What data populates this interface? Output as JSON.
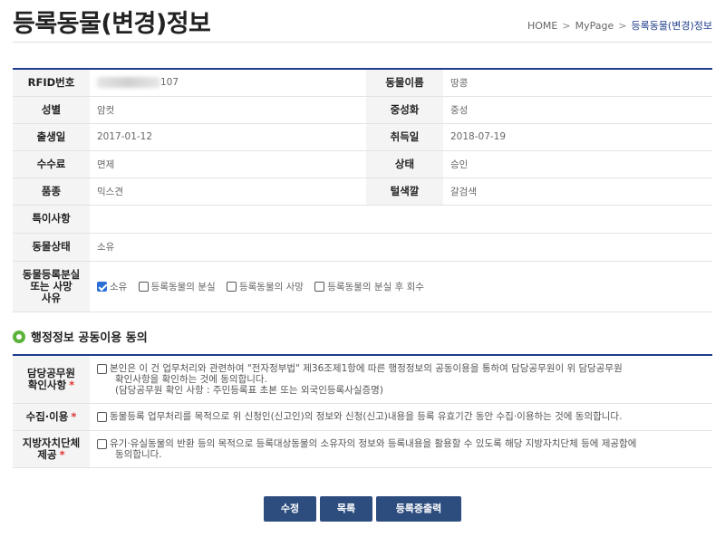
{
  "page": {
    "title": "등록동물(변경)정보"
  },
  "breadcrumb": {
    "home": "HOME",
    "separator": ">",
    "mypage": "MyPage",
    "current": "등록동물(변경)정보"
  },
  "info": {
    "rfid_label": "RFID번호",
    "rfid_suffix": "107",
    "animal_name_label": "동물이름",
    "animal_name": "땅콩",
    "sex_label": "성별",
    "sex": "암컷",
    "neuter_label": "중성화",
    "neuter": "중성",
    "birth_label": "출생일",
    "birth": "2017-01-12",
    "acquire_label": "취득일",
    "acquire": "2018-07-19",
    "fee_label": "수수료",
    "fee": "면제",
    "status_label": "상태",
    "status": "승인",
    "breed_label": "품종",
    "breed": "믹스견",
    "color_label": "털색깔",
    "color": "갈검색",
    "special_label": "특이사항",
    "special": "",
    "animal_state_label": "동물상태",
    "animal_state": "소유",
    "loss_reason_label_l1": "동물등록분실",
    "loss_reason_label_l2": "또는 사망",
    "loss_reason_label_l3": "사유",
    "loss_reason_options": [
      {
        "label": "소유",
        "checked": true
      },
      {
        "label": "등록동물의 분실",
        "checked": false
      },
      {
        "label": "등록동물의 사망",
        "checked": false
      },
      {
        "label": "등록동물의 분실 후 회수",
        "checked": false
      }
    ]
  },
  "consent": {
    "section_title": "행정정보 공동이용 동의",
    "required_mark": "*",
    "officer_label_l1": "담당공무원",
    "officer_label_l2": "확인사항",
    "officer_text_l1": "본인은 이 건 업무처리와 관련하여 \"전자정부법\" 제36조제1항에 따른 행정정보의 공동이용을 통하여 담당공무원이 위 담당공무원",
    "officer_text_l2": "확인사항을 확인하는 것에 동의합니다.",
    "officer_text_l3": "(담당공무원 확인 사항 : 주민등록표 초본 또는 외국인등록사실증명)",
    "collect_label": "수집·이용",
    "collect_text": "동물등록 업무처리를 목적으로 위 신청인(신고인)의 정보와 신청(신고)내용을 등록 유효기간 동안 수집·이용하는 것에 동의합니다.",
    "local_label_l1": "지방자치단체",
    "local_label_l2": "제공",
    "local_text_l1": "유기·유실동물의 반환 등의 목적으로 등록대상동물의 소유자의 정보와 등록내용을 활용할 수 있도록 해당 지방자치단체 등에 제공함에",
    "local_text_l2": "동의합니다."
  },
  "buttons": {
    "modify": "수정",
    "list": "목록",
    "print": "등록증출력"
  },
  "colors": {
    "accent_navy": "#1f3d8c",
    "button_bg": "#2e4d7f",
    "required_red": "#dd3333",
    "section_icon_green": "#5bb33a",
    "checkbox_checked_blue": "#2b6fd6"
  }
}
